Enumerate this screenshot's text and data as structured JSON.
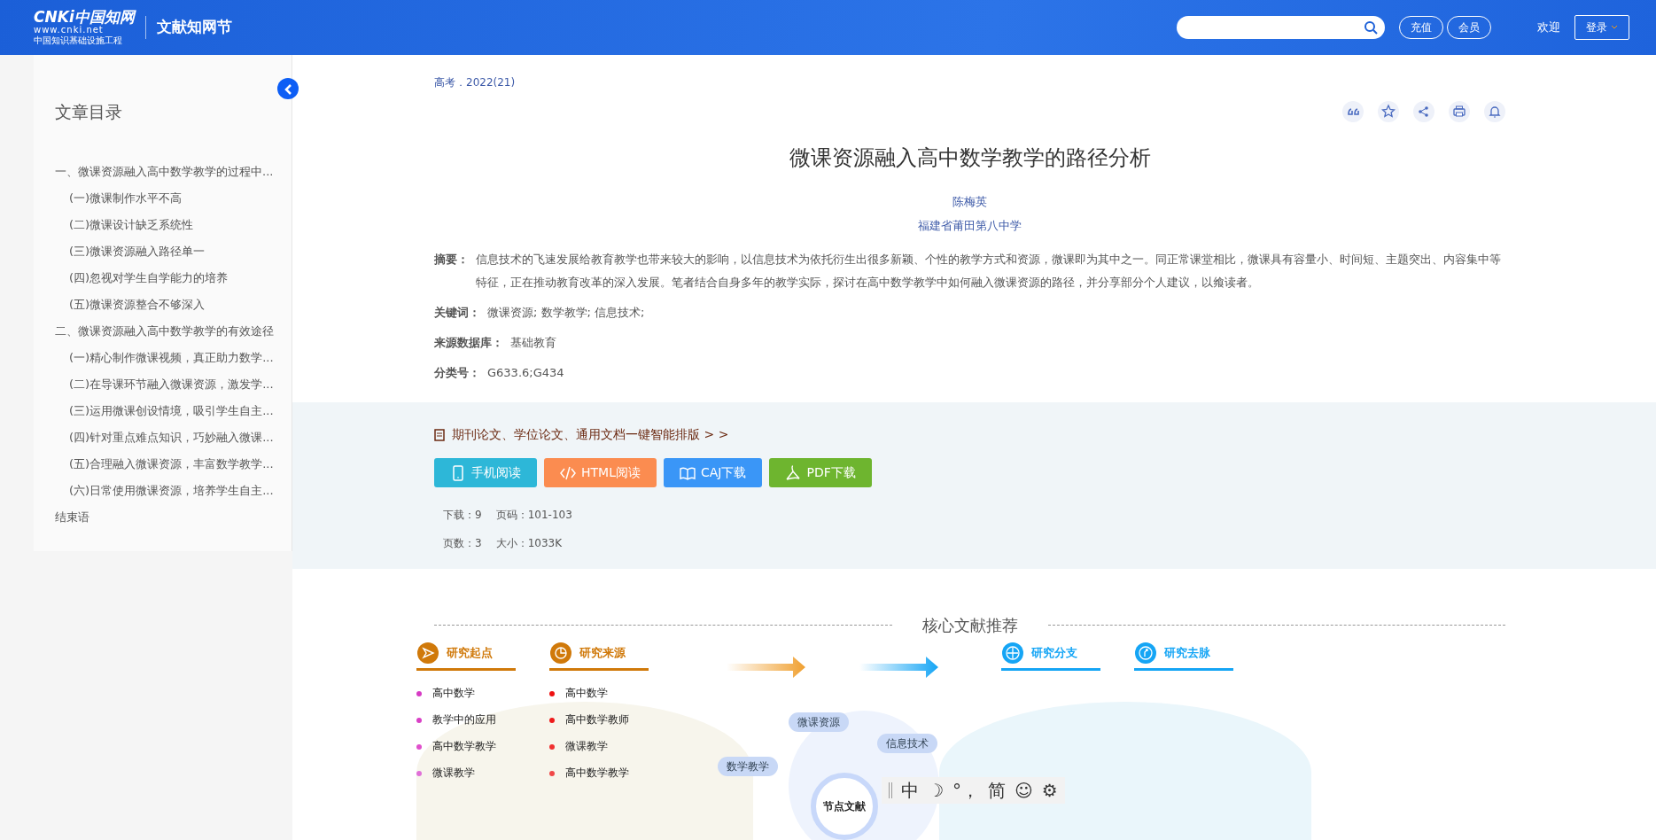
{
  "header": {
    "logo_main": "CNKi中国知网",
    "logo_url": "www.cnki.net",
    "logo_sub": "中国知识基础设施工程",
    "site_name": "文献知网节",
    "buttons": [
      "充值",
      "会员"
    ],
    "welcome": "欢迎",
    "login": "登录"
  },
  "sidebar": {
    "title": "文章目录",
    "items": [
      {
        "label": "一、微课资源融入高中数学教学的过程中...",
        "children": [
          {
            "label": "(一)微课制作水平不高"
          },
          {
            "label": "(二)微课设计缺乏系统性"
          },
          {
            "label": "(三)微课资源融入路径单一"
          },
          {
            "label": "(四)忽视对学生自学能力的培养"
          },
          {
            "label": "(五)微课资源整合不够深入"
          }
        ]
      },
      {
        "label": "二、微课资源融入高中数学教学的有效途径",
        "children": [
          {
            "label": "(一)精心制作微课视频，真正助力数学..."
          },
          {
            "label": "(二)在导课环节融入微课资源，激发学..."
          },
          {
            "label": "(三)运用微课创设情境，吸引学生自主..."
          },
          {
            "label": "(四)针对重点难点知识，巧妙融入微课..."
          },
          {
            "label": "(五)合理融入微课资源，丰富数学教学..."
          },
          {
            "label": "(六)日常使用微课资源，培养学生自主..."
          }
        ]
      },
      {
        "label": "结束语"
      }
    ]
  },
  "article": {
    "source": "高考．2022(21)",
    "title": "微课资源融入高中数学教学的路径分析",
    "author": "陈梅英",
    "institution": "福建省莆田第八中学",
    "fields": [
      {
        "label": "摘要：",
        "value": "信息技术的飞速发展给教育教学也带来较大的影响，以信息技术为依托衍生出很多新颖、个性的教学方式和资源，微课即为其中之一。同正常课堂相比，微课具有容量小、时间短、主题突出、内容集中等特征，正在推动教育改革的深入发展。笔者结合自身多年的教学实际，探讨在高中数学教学中如何融入微课资源的路径，并分享部分个人建议，以飨读者。"
      },
      {
        "label": "关键词：",
        "value": "微课资源;  数学教学;  信息技术;"
      },
      {
        "label": "来源数据库：",
        "value": "基础教育"
      },
      {
        "label": "分类号：",
        "value": "G633.6;G434"
      }
    ]
  },
  "download": {
    "promo": "期刊论文、学位论文、通用文档一键智能排版 > >",
    "buttons": [
      {
        "kind": "mobile",
        "label": "手机阅读"
      },
      {
        "kind": "html",
        "label": "HTML阅读"
      },
      {
        "kind": "caj",
        "label": "CAJ下载"
      },
      {
        "kind": "pdf",
        "label": "PDF下载"
      }
    ],
    "stats": [
      [
        "下载：9",
        "页码：101-103"
      ],
      [
        "页数：3",
        "大小：1033K"
      ]
    ]
  },
  "recommend": {
    "title": "核心文献推荐",
    "sections": [
      {
        "kind": "start",
        "label": "研究起点",
        "items": [
          {
            "label": "高中数学",
            "color": "#d63bc4"
          },
          {
            "label": "教学中的应用",
            "color": "#d940c6"
          },
          {
            "label": "高中数学教学",
            "color": "#e050cc"
          },
          {
            "label": "微课教学",
            "color": "#e070d8"
          }
        ]
      },
      {
        "kind": "source",
        "label": "研究来源",
        "items": [
          {
            "label": "高中数学",
            "color": "#ee1111"
          },
          {
            "label": "高中数学教师",
            "color": "#ee1a1a"
          },
          {
            "label": "微课教学",
            "color": "#f03030"
          },
          {
            "label": "高中数学教学",
            "color": "#f04848"
          }
        ]
      },
      {
        "kind": "branch",
        "label": "研究分支"
      },
      {
        "kind": "trend",
        "label": "研究去脉"
      }
    ],
    "nodes": [
      "微课资源",
      "数学教学",
      "信息技术"
    ],
    "center": "节点文献"
  },
  "ime_toolbar": [
    "中",
    "☽",
    "°，",
    "简",
    "☺",
    "⚙"
  ]
}
